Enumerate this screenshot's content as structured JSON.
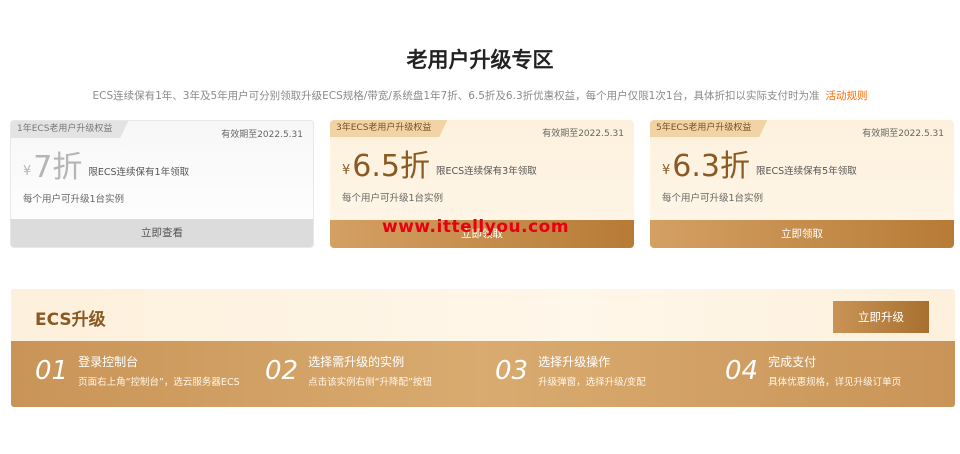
{
  "header": {
    "title": "老用户升级专区",
    "subtitle": "ECS连续保有1年、3年及5年用户可分别领取升级ECS规格/带宽/系统盘1年7折、6.5折及6.3折优惠权益，每个用户仅限1次1台，具体折扣以实际支付时为准",
    "rules_link": "活动规则"
  },
  "cards": [
    {
      "tag": "1年ECS老用户升级权益",
      "valid": "有效期至2022.5.31",
      "currency": "¥",
      "discount": "7折",
      "condition": "限ECS连续保有1年领取",
      "limit": "每个用户可升级1台实例",
      "button": "立即查看"
    },
    {
      "tag": "3年ECS老用户升级权益",
      "valid": "有效期至2022.5.31",
      "currency": "¥",
      "discount": "6.5折",
      "condition": "限ECS连续保有3年领取",
      "limit": "每个用户可升级1台实例",
      "button": "立即领取"
    },
    {
      "tag": "5年ECS老用户升级权益",
      "valid": "有效期至2022.5.31",
      "currency": "¥",
      "discount": "6.3折",
      "condition": "限ECS连续保有5年领取",
      "limit": "每个用户可升级1台实例",
      "button": "立即领取"
    }
  ],
  "watermark": "www.ittellyou.com",
  "upgrade": {
    "title": "ECS升级",
    "button": "立即升级",
    "steps": [
      {
        "num": "01",
        "title": "登录控制台",
        "desc": "页面右上角“控制台”，选云服务器ECS"
      },
      {
        "num": "02",
        "title": "选择需升级的实例",
        "desc": "点击该实例右侧“升降配”按钮"
      },
      {
        "num": "03",
        "title": "选择升级操作",
        "desc": "升级弹窗，选择升级/变配"
      },
      {
        "num": "04",
        "title": "完成支付",
        "desc": "具体优惠规格，详见升级订单页"
      }
    ]
  },
  "colors": {
    "accent": "#ff6a00",
    "gold_dark": "#8a5a22",
    "gold_button": "#b77b36",
    "watermark": "#e60012"
  }
}
